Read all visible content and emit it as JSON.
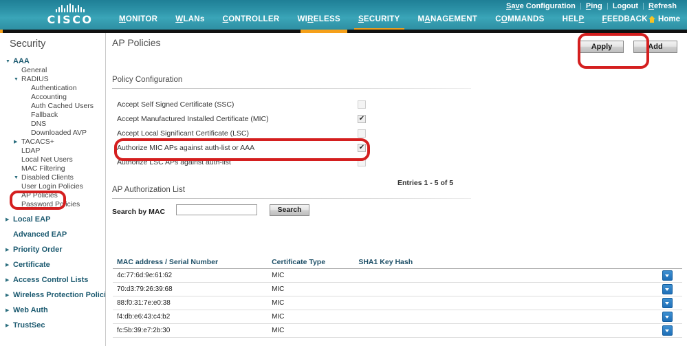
{
  "header": {
    "brand": "CISCO",
    "utility_links": [
      {
        "label": "Save Configuration",
        "name": "save-configuration-link"
      },
      {
        "label": "Ping",
        "name": "ping-link"
      },
      {
        "label": "Logout",
        "name": "logout-link"
      },
      {
        "label": "Refresh",
        "name": "refresh-link"
      }
    ],
    "nav": [
      {
        "label": "MONITOR",
        "active": false
      },
      {
        "label": "WLANs",
        "active": false
      },
      {
        "label": "CONTROLLER",
        "active": false
      },
      {
        "label": "WIRELESS",
        "active": false
      },
      {
        "label": "SECURITY",
        "active": true
      },
      {
        "label": "MANAGEMENT",
        "active": false
      },
      {
        "label": "COMMANDS",
        "active": false
      },
      {
        "label": "HELP",
        "active": false
      },
      {
        "label": "FEEDBACK",
        "active": false
      }
    ],
    "home_label": "Home"
  },
  "sidebar": {
    "title": "Security",
    "items": [
      {
        "label": "AAA",
        "level": 1,
        "style": "bold",
        "arrow": "down"
      },
      {
        "label": "General",
        "level": 2,
        "style": "plain",
        "arrow": "none"
      },
      {
        "label": "RADIUS",
        "level": 2,
        "style": "plain",
        "arrow": "down"
      },
      {
        "label": "Authentication",
        "level": 3,
        "style": "plain",
        "arrow": "none"
      },
      {
        "label": "Accounting",
        "level": 3,
        "style": "plain",
        "arrow": "none"
      },
      {
        "label": "Auth Cached Users",
        "level": 3,
        "style": "plain",
        "arrow": "none"
      },
      {
        "label": "Fallback",
        "level": 3,
        "style": "plain",
        "arrow": "none"
      },
      {
        "label": "DNS",
        "level": 3,
        "style": "plain",
        "arrow": "none"
      },
      {
        "label": "Downloaded AVP",
        "level": 3,
        "style": "plain",
        "arrow": "none"
      },
      {
        "label": "TACACS+",
        "level": 2,
        "style": "plain",
        "arrow": "right"
      },
      {
        "label": "LDAP",
        "level": 2,
        "style": "plain",
        "arrow": "none"
      },
      {
        "label": "Local Net Users",
        "level": 2,
        "style": "plain",
        "arrow": "none"
      },
      {
        "label": "MAC Filtering",
        "level": 2,
        "style": "plain",
        "arrow": "none"
      },
      {
        "label": "Disabled Clients",
        "level": 2,
        "style": "plain",
        "arrow": "down"
      },
      {
        "label": "User Login Policies",
        "level": 2,
        "style": "plain",
        "arrow": "none"
      },
      {
        "label": "AP Policies",
        "level": 2,
        "style": "plain",
        "arrow": "none"
      },
      {
        "label": "Password Policies",
        "level": 2,
        "style": "plain",
        "arrow": "none"
      },
      {
        "label": "Local EAP",
        "level": 1,
        "style": "bold",
        "arrow": "right"
      },
      {
        "label": "Advanced EAP",
        "level": 1,
        "style": "bold",
        "arrow": "none"
      },
      {
        "label": "Priority Order",
        "level": 1,
        "style": "bold",
        "arrow": "right"
      },
      {
        "label": "Certificate",
        "level": 1,
        "style": "bold",
        "arrow": "right"
      },
      {
        "label": "Access Control Lists",
        "level": 1,
        "style": "bold",
        "arrow": "right"
      },
      {
        "label": "Wireless Protection Policies",
        "level": 1,
        "style": "bold",
        "arrow": "right"
      },
      {
        "label": "Web Auth",
        "level": 1,
        "style": "bold",
        "arrow": "right"
      },
      {
        "label": "TrustSec",
        "level": 1,
        "style": "bold",
        "arrow": "right"
      }
    ]
  },
  "main": {
    "page_title": "AP Policies",
    "apply_label": "Apply",
    "add_label": "Add",
    "policy_config_heading": "Policy Configuration",
    "policy_options": [
      {
        "label": "Accept Self Signed Certificate (SSC)",
        "checked": false
      },
      {
        "label": "Accept Manufactured Installed Certificate (MIC)",
        "checked": true
      },
      {
        "label": "Accept Local Significant Certificate (LSC)",
        "checked": false
      },
      {
        "label": "Authorize MIC APs against auth-list or AAA",
        "checked": true
      },
      {
        "label": "Authorize LSC APs against auth-list",
        "checked": false
      }
    ],
    "auth_list_heading": "AP Authorization List",
    "entries_text": "Entries 1 - 5 of 5",
    "search_label": "Search by MAC",
    "search_value": "",
    "search_placeholder": "",
    "search_button": "Search",
    "table": {
      "columns": [
        "MAC address / Serial Number",
        "Certificate Type",
        "SHA1 Key Hash",
        ""
      ],
      "rows": [
        {
          "mac": "4c:77:6d:9e:61:62",
          "cert": "MIC",
          "sha1": ""
        },
        {
          "mac": "70:d3:79:26:39:68",
          "cert": "MIC",
          "sha1": ""
        },
        {
          "mac": "88:f0:31:7e:e0:38",
          "cert": "MIC",
          "sha1": ""
        },
        {
          "mac": "f4:db:e6:43:c4:b2",
          "cert": "MIC",
          "sha1": ""
        },
        {
          "mac": "fc:5b:39:e7:2b:30",
          "cert": "MIC",
          "sha1": ""
        }
      ]
    }
  },
  "annotations": {
    "color": "#d41f1f",
    "shapes": [
      "apply-button-highlight",
      "authorize-mic-row-highlight",
      "ap-policies-sidebar-highlight"
    ]
  }
}
